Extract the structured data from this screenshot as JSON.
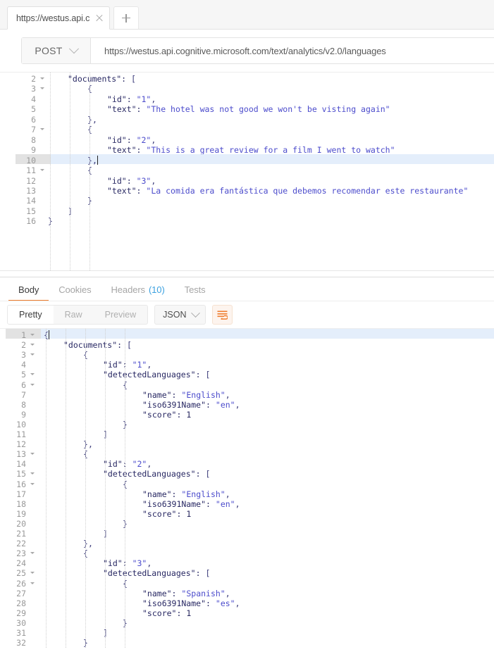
{
  "window": {
    "tab": {
      "label": "https://westus.api.cog",
      "close_icon": "close-icon",
      "new_tab_icon": "plus-icon"
    }
  },
  "request": {
    "method": "POST",
    "method_caret_icon": "chevron-down-icon",
    "url": "https://westus.api.cognitive.microsoft.com/text/analytics/v2.0/languages",
    "body_lines": [
      {
        "n": 2,
        "fold": true,
        "indent": 1,
        "text": "\"documents\": ["
      },
      {
        "n": 3,
        "fold": true,
        "indent": 2,
        "text": "{"
      },
      {
        "n": 4,
        "fold": false,
        "indent": 3,
        "text": "\"id\": \"1\","
      },
      {
        "n": 5,
        "fold": false,
        "indent": 3,
        "text": "\"text\": \"The hotel was not good we won't be visting again\""
      },
      {
        "n": 6,
        "fold": false,
        "indent": 2,
        "text": "},"
      },
      {
        "n": 7,
        "fold": true,
        "indent": 2,
        "text": "{"
      },
      {
        "n": 8,
        "fold": false,
        "indent": 3,
        "text": "\"id\": \"2\","
      },
      {
        "n": 9,
        "fold": false,
        "indent": 3,
        "text": "\"text\": \"This is a great review for a film I went to watch\""
      },
      {
        "n": 10,
        "fold": false,
        "indent": 2,
        "text": "},"
      },
      {
        "n": 11,
        "fold": true,
        "indent": 2,
        "text": "{"
      },
      {
        "n": 12,
        "fold": false,
        "indent": 3,
        "text": "\"id\": \"3\","
      },
      {
        "n": 13,
        "fold": false,
        "indent": 3,
        "text": "\"text\": \"La comida era fantástica que debemos recomendar este restaurante\""
      },
      {
        "n": 14,
        "fold": false,
        "indent": 2,
        "text": "}"
      },
      {
        "n": 15,
        "fold": false,
        "indent": 1,
        "text": "]"
      },
      {
        "n": 16,
        "fold": false,
        "indent": 0,
        "text": "}"
      }
    ],
    "active_line": 10
  },
  "response": {
    "tabs": [
      {
        "label": "Body",
        "active": true,
        "count": ""
      },
      {
        "label": "Cookies",
        "active": false,
        "count": ""
      },
      {
        "label": "Headers",
        "active": false,
        "count": "(10)"
      },
      {
        "label": "Tests",
        "active": false,
        "count": ""
      }
    ],
    "view_modes": [
      {
        "label": "Pretty",
        "active": true
      },
      {
        "label": "Raw",
        "active": false
      },
      {
        "label": "Preview",
        "active": false
      }
    ],
    "format": "JSON",
    "format_caret_icon": "chevron-down-icon",
    "wrap_lines_icon": "wrap-lines-icon",
    "active_line": 1,
    "body_lines": [
      {
        "n": 1,
        "fold": true,
        "indent": 0,
        "text": "{"
      },
      {
        "n": 2,
        "fold": true,
        "indent": 1,
        "text": "\"documents\": ["
      },
      {
        "n": 3,
        "fold": true,
        "indent": 2,
        "text": "{"
      },
      {
        "n": 4,
        "fold": false,
        "indent": 3,
        "text": "\"id\": \"1\","
      },
      {
        "n": 5,
        "fold": true,
        "indent": 3,
        "text": "\"detectedLanguages\": ["
      },
      {
        "n": 6,
        "fold": true,
        "indent": 4,
        "text": "{"
      },
      {
        "n": 7,
        "fold": false,
        "indent": 5,
        "text": "\"name\": \"English\","
      },
      {
        "n": 8,
        "fold": false,
        "indent": 5,
        "text": "\"iso6391Name\": \"en\","
      },
      {
        "n": 9,
        "fold": false,
        "indent": 5,
        "text": "\"score\": 1"
      },
      {
        "n": 10,
        "fold": false,
        "indent": 4,
        "text": "}"
      },
      {
        "n": 11,
        "fold": false,
        "indent": 3,
        "text": "]"
      },
      {
        "n": 12,
        "fold": false,
        "indent": 2,
        "text": "},"
      },
      {
        "n": 13,
        "fold": true,
        "indent": 2,
        "text": "{"
      },
      {
        "n": 14,
        "fold": false,
        "indent": 3,
        "text": "\"id\": \"2\","
      },
      {
        "n": 15,
        "fold": true,
        "indent": 3,
        "text": "\"detectedLanguages\": ["
      },
      {
        "n": 16,
        "fold": true,
        "indent": 4,
        "text": "{"
      },
      {
        "n": 17,
        "fold": false,
        "indent": 5,
        "text": "\"name\": \"English\","
      },
      {
        "n": 18,
        "fold": false,
        "indent": 5,
        "text": "\"iso6391Name\": \"en\","
      },
      {
        "n": 19,
        "fold": false,
        "indent": 5,
        "text": "\"score\": 1"
      },
      {
        "n": 20,
        "fold": false,
        "indent": 4,
        "text": "}"
      },
      {
        "n": 21,
        "fold": false,
        "indent": 3,
        "text": "]"
      },
      {
        "n": 22,
        "fold": false,
        "indent": 2,
        "text": "},"
      },
      {
        "n": 23,
        "fold": true,
        "indent": 2,
        "text": "{"
      },
      {
        "n": 24,
        "fold": false,
        "indent": 3,
        "text": "\"id\": \"3\","
      },
      {
        "n": 25,
        "fold": true,
        "indent": 3,
        "text": "\"detectedLanguages\": ["
      },
      {
        "n": 26,
        "fold": true,
        "indent": 4,
        "text": "{"
      },
      {
        "n": 27,
        "fold": false,
        "indent": 5,
        "text": "\"name\": \"Spanish\","
      },
      {
        "n": 28,
        "fold": false,
        "indent": 5,
        "text": "\"iso6391Name\": \"es\","
      },
      {
        "n": 29,
        "fold": false,
        "indent": 5,
        "text": "\"score\": 1"
      },
      {
        "n": 30,
        "fold": false,
        "indent": 4,
        "text": "}"
      },
      {
        "n": 31,
        "fold": false,
        "indent": 3,
        "text": "]"
      },
      {
        "n": 32,
        "fold": false,
        "indent": 2,
        "text": "}"
      }
    ]
  },
  "colors": {
    "accent": "#ef7d2e",
    "link": "#3ba1e0",
    "json_key": "#282863",
    "json_string": "#4c4ccc",
    "gutter_bg": "#f0f0f0",
    "active_line": "#e4eefb"
  }
}
